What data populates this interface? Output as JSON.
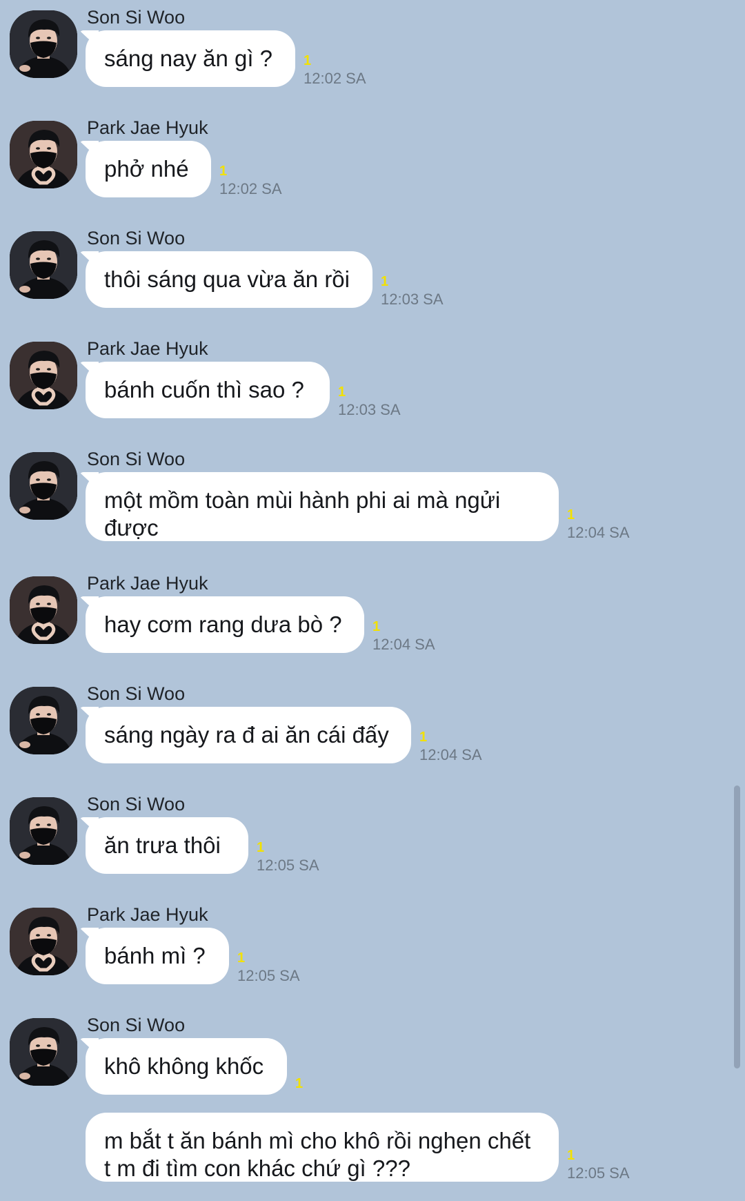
{
  "messages": [
    {
      "sender": "Son Si Woo",
      "avatar": "sonsiwoo",
      "text": "sáng nay ăn gì ?",
      "unread": "1",
      "time": "12:02 SA"
    },
    {
      "sender": "Park Jae Hyuk",
      "avatar": "parkjaehyuk",
      "text": "phở nhé",
      "unread": "1",
      "time": "12:02 SA"
    },
    {
      "sender": "Son Si Woo",
      "avatar": "sonsiwoo",
      "text": "thôi sáng qua vừa ăn rồi",
      "unread": "1",
      "time": "12:03 SA"
    },
    {
      "sender": "Park Jae Hyuk",
      "avatar": "parkjaehyuk",
      "text": "bánh cuốn thì sao ?",
      "unread": "1",
      "time": "12:03 SA"
    },
    {
      "sender": "Son Si Woo",
      "avatar": "sonsiwoo",
      "text": "một mồm toàn mùi hành phi ai mà ngửi được",
      "unread": "1",
      "time": "12:04 SA"
    },
    {
      "sender": "Park Jae Hyuk",
      "avatar": "parkjaehyuk",
      "text": "hay cơm rang dưa bò ?",
      "unread": "1",
      "time": "12:04 SA"
    },
    {
      "sender": "Son Si Woo",
      "avatar": "sonsiwoo",
      "text": "sáng ngày ra đ ai ăn cái đấy",
      "unread": "1",
      "time": "12:04 SA"
    },
    {
      "sender": "Son Si Woo",
      "avatar": "sonsiwoo",
      "text": "ăn trưa thôi",
      "unread": "1",
      "time": "12:05 SA"
    },
    {
      "sender": "Park Jae Hyuk",
      "avatar": "parkjaehyuk",
      "text": "bánh mì ?",
      "unread": "1",
      "time": "12:05 SA"
    },
    {
      "sender": "Son Si Woo",
      "avatar": "sonsiwoo",
      "text": "khô không khốc",
      "unread": "1",
      "time": ""
    },
    {
      "sender": "",
      "avatar": "",
      "text": "m bắt t ăn bánh mì cho khô rồi nghẹn chết t m đi tìm con khác chứ gì ???",
      "unread": "1",
      "time": "12:05 SA"
    }
  ],
  "colors": {
    "background": "#b1c4d9",
    "bubble": "#ffffff",
    "unread": "#f2e100",
    "timestamp": "#6c7885"
  }
}
